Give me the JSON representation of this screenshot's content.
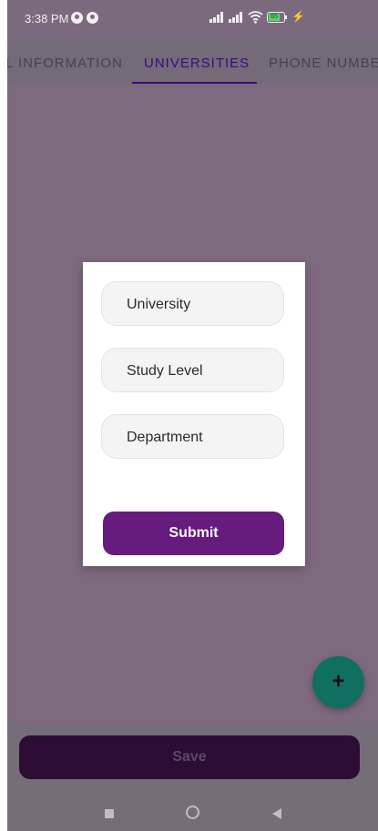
{
  "status_bar": {
    "time": "3:38 PM",
    "battery_level": "65",
    "icons": [
      "notification-dot-icon",
      "notification-dot-icon",
      "signal-icon",
      "signal-icon",
      "wifi-icon",
      "battery-icon",
      "charging-bolt-icon"
    ]
  },
  "tabs": [
    {
      "label": "L INFORMATION",
      "active": false
    },
    {
      "label": "UNIVERSITIES",
      "active": true
    },
    {
      "label": "PHONE NUMBER",
      "active": false
    }
  ],
  "dialog": {
    "fields": [
      {
        "placeholder": "University"
      },
      {
        "placeholder": "Study Level"
      },
      {
        "placeholder": "Department"
      }
    ],
    "submit_label": "Submit"
  },
  "fab": {
    "icon": "plus-icon",
    "glyph": "+"
  },
  "save_label": "Save",
  "nav": {
    "icons": [
      "recent-apps-icon",
      "home-icon",
      "back-icon"
    ]
  },
  "colors": {
    "accent": "#3b0a86",
    "submit": "#671b7d",
    "fab": "#0f6f61",
    "save": "#2d0d34",
    "scrim": "#7e6a7f"
  }
}
